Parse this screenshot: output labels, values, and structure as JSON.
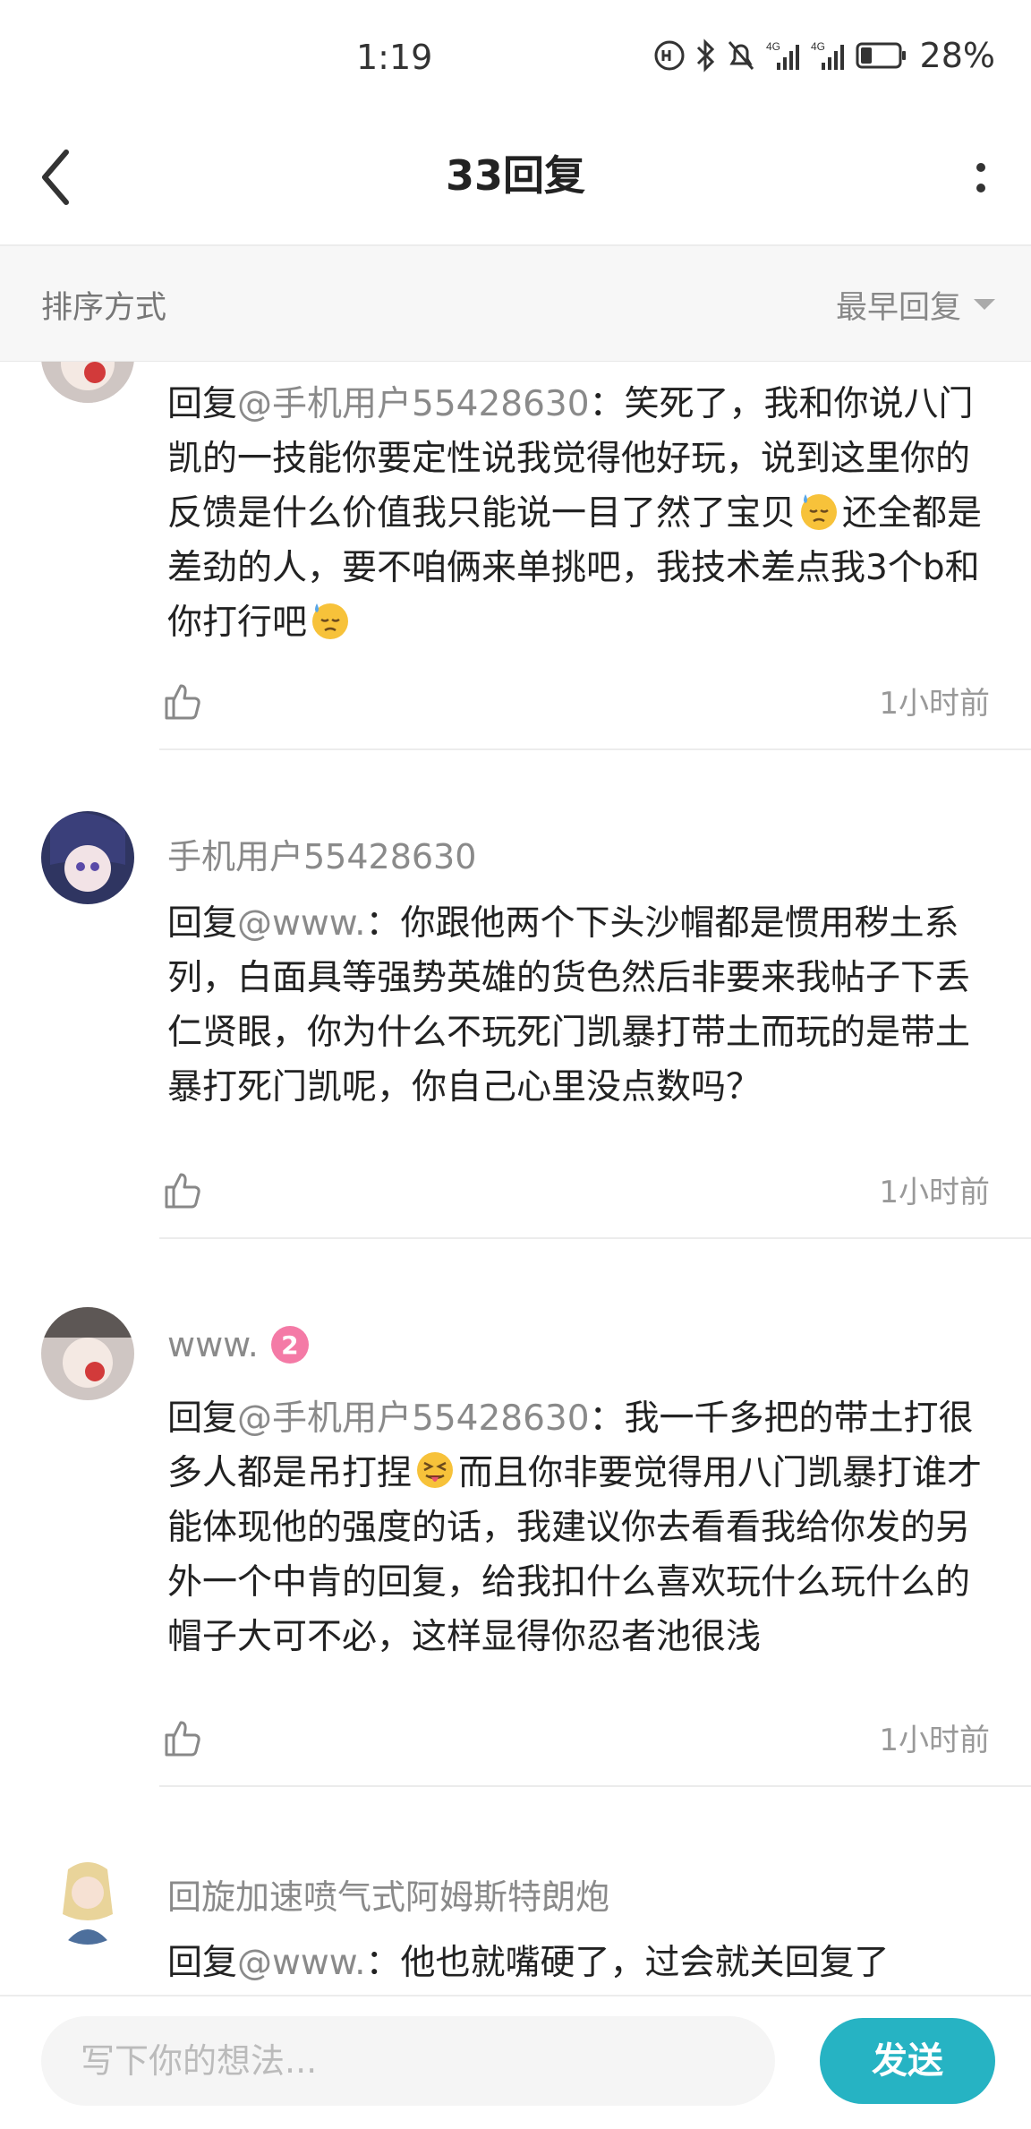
{
  "status": {
    "time": "1:19",
    "battery": "28%",
    "net1": "4G",
    "net2": "4G"
  },
  "header": {
    "title": "33回复"
  },
  "sort": {
    "label": "排序方式",
    "value": "最早回复"
  },
  "comments": [
    {
      "username": "",
      "reply_prefix": "回复",
      "reply_to": "@手机用户55428630",
      "text_parts": [
        "：笑死了，我和你说八门凯的一技能你要定性说我觉得他好玩，说到这里你的反馈是什么价值我只能说一目了然了宝贝",
        "还全都是差劲的人，要不咱俩来单挑吧，我技术差点我3个b和你打行吧",
        ""
      ],
      "time": "1小时前"
    },
    {
      "username": "手机用户55428630",
      "reply_prefix": "回复",
      "reply_to": "@www.",
      "text_parts": [
        "：你跟他两个下头沙帽都是惯用秽土系列，白面具等强势英雄的货色然后非要来我帖子下丢仁贤眼，你为什么不玩死门凯暴打带土而玩的是带土暴打死门凯呢，你自己心里没点数吗？"
      ],
      "time": "1小时前"
    },
    {
      "username": "www.",
      "level": "2",
      "reply_prefix": "回复",
      "reply_to": "@手机用户55428630",
      "text_parts": [
        "：我一千多把的带土打很多人都是吊打捏",
        "而且你非要觉得用八门凯暴打谁才能体现他的强度的话，我建议你去看看我给你发的另外一个中肯的回复，给我扣什么喜欢玩什么玩什么的帽子大可不必，这样显得你忍者池很浅"
      ],
      "time": "1小时前"
    },
    {
      "username": "回旋加速喷气式阿姆斯特朗炮",
      "reply_prefix": "回复",
      "reply_to": "@www.",
      "text_parts": [
        "：他也就嘴硬了，过会就关回复了"
      ]
    }
  ],
  "input": {
    "placeholder": "写下你的想法...",
    "send_label": "发送"
  },
  "colors": {
    "accent": "#26b3c3",
    "level_badge": "#f47aa6"
  }
}
